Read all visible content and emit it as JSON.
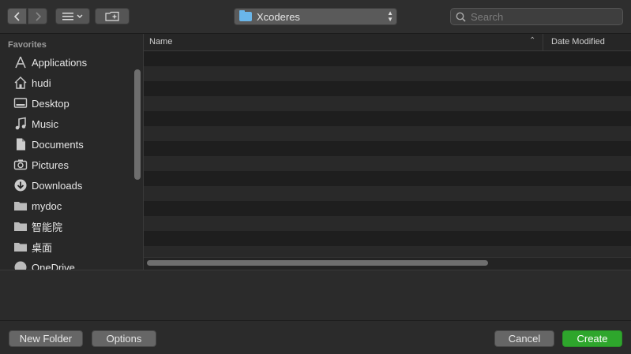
{
  "toolbar": {
    "view_icon": "list-view-icon",
    "new_folder_icon": "new-folder-icon",
    "path": "Xcoderes",
    "search_placeholder": "Search"
  },
  "sidebar": {
    "heading": "Favorites",
    "items": [
      {
        "label": "Applications",
        "icon": "applications-icon"
      },
      {
        "label": "hudi",
        "icon": "home-icon"
      },
      {
        "label": "Desktop",
        "icon": "desktop-icon"
      },
      {
        "label": "Music",
        "icon": "music-icon"
      },
      {
        "label": "Documents",
        "icon": "documents-icon"
      },
      {
        "label": "Pictures",
        "icon": "camera-icon"
      },
      {
        "label": "Downloads",
        "icon": "download-icon"
      },
      {
        "label": "mydoc",
        "icon": "folder-icon"
      },
      {
        "label": "智能院",
        "icon": "folder-icon"
      },
      {
        "label": "桌面",
        "icon": "folder-icon"
      },
      {
        "label": "OneDrive",
        "icon": "cloud-icon"
      }
    ]
  },
  "file_list": {
    "columns": [
      "Name",
      "Date Modified"
    ],
    "rows": []
  },
  "buttons": {
    "new_folder": "New Folder",
    "options": "Options",
    "cancel": "Cancel",
    "create": "Create"
  },
  "colors": {
    "accent": "#2ea62c",
    "folder": "#6ab6ea"
  }
}
